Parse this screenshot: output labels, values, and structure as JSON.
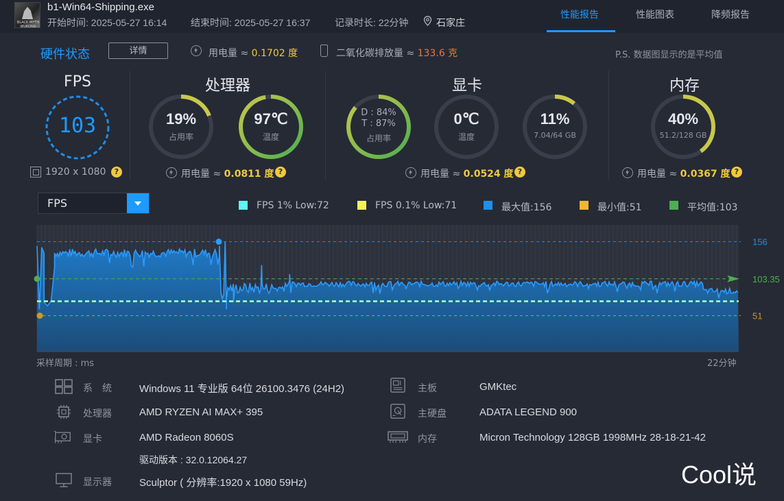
{
  "header": {
    "app_name": "b1-Win64-Shipping.exe",
    "app_icon_text": "BLACK MYTH WUKONG",
    "start_time": "开始时间: 2025-05-27 16:14",
    "end_time": "结束时间: 2025-05-27 16:37",
    "duration": "记录时长: 22分钟",
    "location": "石家庄",
    "tabs": [
      "性能报告",
      "性能图表",
      "降频报告"
    ],
    "active_tab": "性能报告"
  },
  "hw_status": {
    "title": "硬件状态",
    "detail_button": "详情",
    "power_label": "用电量 ≈",
    "power_value": "0.1702 度",
    "co2_label": "二氧化碳排放量 ≈",
    "co2_value": "133.6 克",
    "note": "P.S. 数据图显示的是平均值"
  },
  "fps": {
    "title": "FPS",
    "value": "103",
    "resolution": "1920 x 1080"
  },
  "cpu": {
    "title": "处理器",
    "usage": "19%",
    "usage_label": "占用率",
    "usage_fraction": 0.19,
    "temp": "97℃",
    "temp_label": "温度",
    "temp_fraction": 0.97,
    "power_label": "用电量 ≈",
    "power_value": "0.0811 度"
  },
  "gpu": {
    "title": "显卡",
    "d_line": "D : 84%",
    "t_line": "T : 87%",
    "usage_label": "占用率",
    "usage_fraction": 0.86,
    "temp": "0℃",
    "temp_label": "温度",
    "temp_fraction": 0.0,
    "mem": "11%",
    "mem_sub": "7.04/64 GB",
    "mem_fraction": 0.11,
    "power_label": "用电量 ≈",
    "power_value": "0.0524 度"
  },
  "ram": {
    "title": "内存",
    "usage": "40%",
    "usage_sub": "51.2/128 GB",
    "usage_fraction": 0.4,
    "power_label": "用电量 ≈",
    "power_value": "0.0367 度"
  },
  "chart_select": {
    "value": "FPS"
  },
  "legend": [
    {
      "label": "FPS 1% Low:72",
      "color": "#5ff6f6"
    },
    {
      "label": "FPS 0.1% Low:71",
      "color": "#f6f05a"
    },
    {
      "label": "最大值:156",
      "color": "#1e8fea"
    },
    {
      "label": "最小值:51",
      "color": "#f0b830"
    },
    {
      "label": "平均值:103",
      "color": "#4caf50"
    }
  ],
  "chart_data": {
    "type": "area",
    "xlabel": "采样周期 : ms",
    "x_end_label": "22分钟",
    "ylim": [
      0,
      180
    ],
    "max": 156,
    "min": 51,
    "avg": 103.35,
    "low1": 72,
    "low01": 71,
    "reference_labels": [
      "156",
      "103.35",
      "51"
    ],
    "segments": [
      {
        "x_from": 0.0,
        "x_to": 0.01,
        "values": [
          150,
          60,
          148,
          140
        ]
      },
      {
        "x_from": 0.01,
        "x_to": 0.025,
        "values": [
          70,
          65,
          72,
          120
        ]
      },
      {
        "x_from": 0.025,
        "x_to": 0.26,
        "level": 140,
        "jitter": 6
      },
      {
        "x_from": 0.26,
        "x_to": 0.27,
        "values": [
          150,
          85,
          75,
          80,
          156,
          60
        ]
      },
      {
        "x_from": 0.27,
        "x_to": 0.35,
        "level": 90,
        "jitter": 8,
        "spikes": [
          [
            0.28,
            70
          ],
          [
            0.32,
            123
          ],
          [
            0.36,
            110
          ]
        ]
      },
      {
        "x_from": 0.35,
        "x_to": 0.95,
        "level": 96,
        "jitter": 4
      },
      {
        "x_from": 0.95,
        "x_to": 1.0,
        "level": 86,
        "jitter": 4
      }
    ]
  },
  "system_info": {
    "os_label": "系　统",
    "os_value": "Windows 11 专业版 64位 26100.3476 (24H2)",
    "cpu_label": "处理器",
    "cpu_value": "AMD RYZEN AI MAX+ 395",
    "gpu_label": "显卡",
    "gpu_value": "AMD Radeon 8060S",
    "driver_value": "驱动版本 : 32.0.12064.27",
    "display_label": "显示器",
    "display_value": "Sculptor ( 分辨率:1920 x 1080 59Hz)",
    "board_label": "主板",
    "board_value": "GMKtec",
    "disk_label": "主硬盘",
    "disk_value": "ADATA LEGEND 900",
    "mem_label": "内存",
    "mem_value": "Micron Technology 128GB 1998MHz 28-18-21-42"
  },
  "watermark": "Cool说",
  "colors": {
    "accent": "#1e9bff",
    "yellow": "#f0c93c",
    "green": "#4caf50",
    "orange": "#e8763a"
  }
}
